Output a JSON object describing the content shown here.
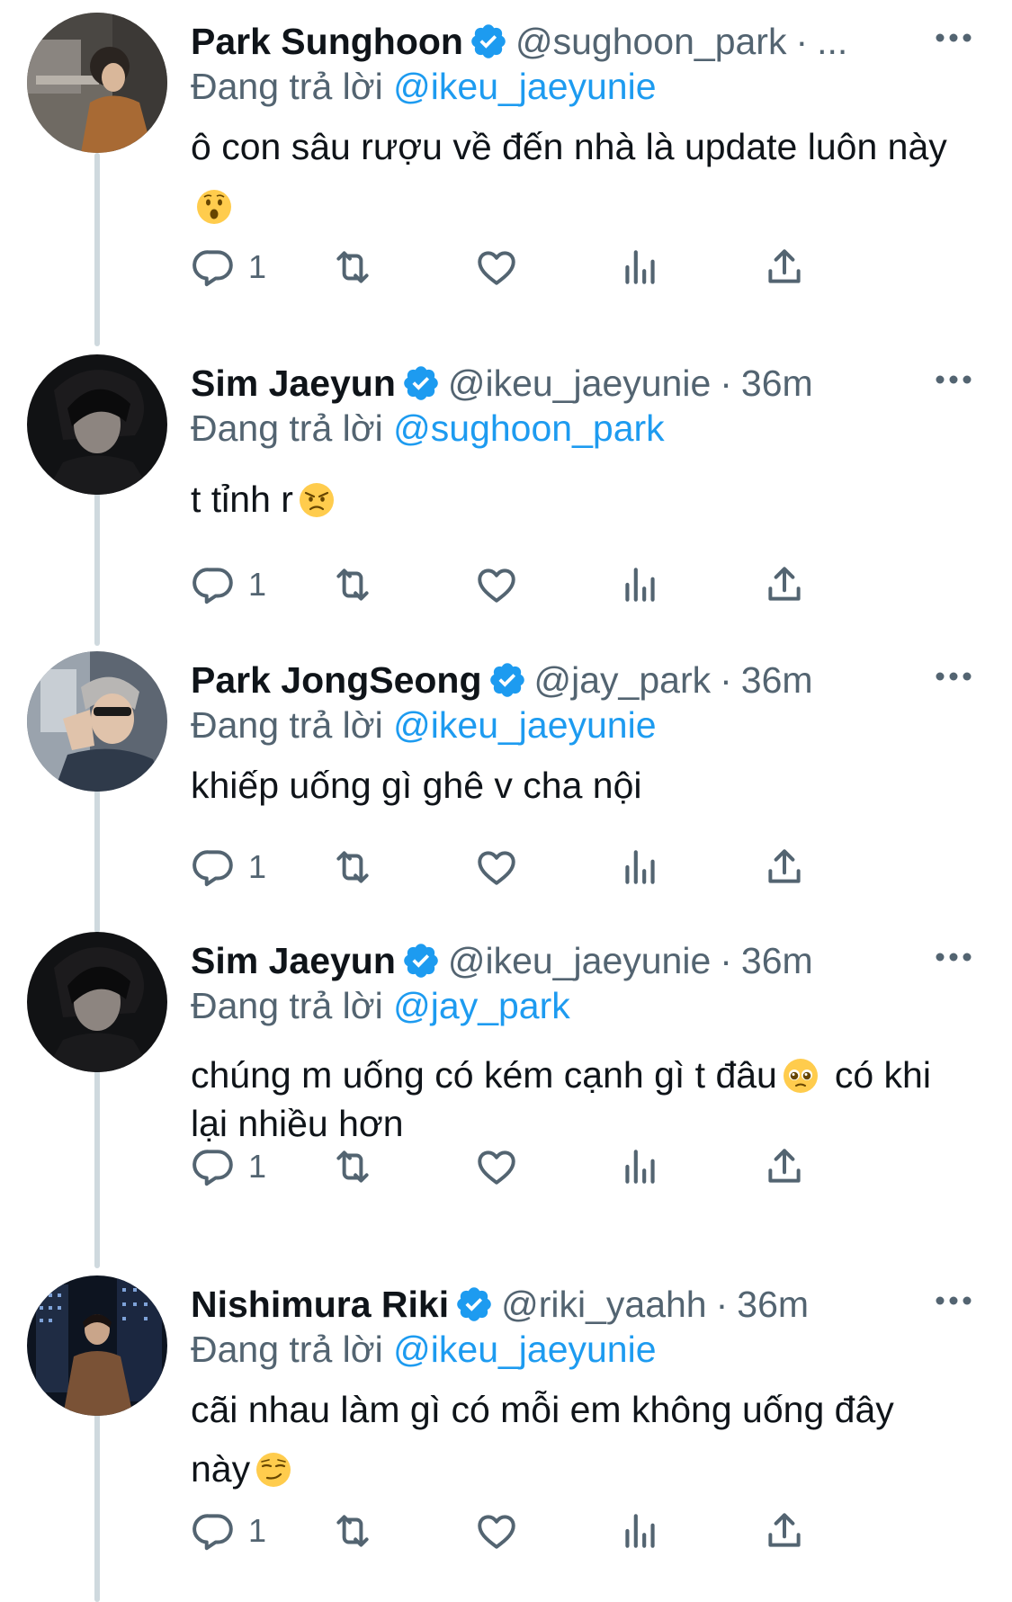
{
  "accent_color": "#1d9bf0",
  "text_secondary_color": "#536471",
  "icons": {
    "verified": "verified-badge-icon",
    "more": "more-options-icon",
    "reply": "reply-icon",
    "retweet": "retweet-icon",
    "like": "like-icon",
    "analytics": "analytics-icon",
    "share": "share-icon"
  },
  "tweets": [
    {
      "name": "Park Sunghoon",
      "handle": "@sughoon_park",
      "dot": "·",
      "time": "...",
      "reply_prefix": "Đang trả lời",
      "reply_mention": "@ikeu_jaeyunie",
      "text": "ô con sâu rượu về đến nhà là update luôn này",
      "emoji": "hushed-face-emoji",
      "reply_count": "1"
    },
    {
      "name": "Sim Jaeyun",
      "handle": "@ikeu_jaeyunie",
      "dot": "·",
      "time": "36m",
      "reply_prefix": "Đang trả lời",
      "reply_mention": "@sughoon_park",
      "text": "t tỉnh r",
      "emoji": "angry-face-emoji",
      "reply_count": "1"
    },
    {
      "name": "Park JongSeong",
      "handle": "@jay_park",
      "dot": "·",
      "time": "36m",
      "reply_prefix": "Đang trả lời",
      "reply_mention": "@ikeu_jaeyunie",
      "text": "khiếp uống gì ghê v cha nội",
      "emoji": "",
      "reply_count": "1"
    },
    {
      "name": "Sim Jaeyun",
      "handle": "@ikeu_jaeyunie",
      "dot": "·",
      "time": "36m",
      "reply_prefix": "Đang trả lời",
      "reply_mention": "@jay_park",
      "text_before_emoji": "chúng m uống có kém cạnh gì t đâu",
      "text_after_emoji": "có khi lại nhiều hơn",
      "emoji": "pleading-face-emoji",
      "reply_count": "1"
    },
    {
      "name": "Nishimura Riki",
      "handle": "@riki_yaahh",
      "dot": "·",
      "time": "36m",
      "reply_prefix": "Đang trả lời",
      "reply_mention": "@ikeu_jaeyunie",
      "text": "cãi nhau làm gì có mỗi em không uống đây này",
      "emoji": "smirking-face-emoji",
      "reply_count": "1"
    }
  ]
}
